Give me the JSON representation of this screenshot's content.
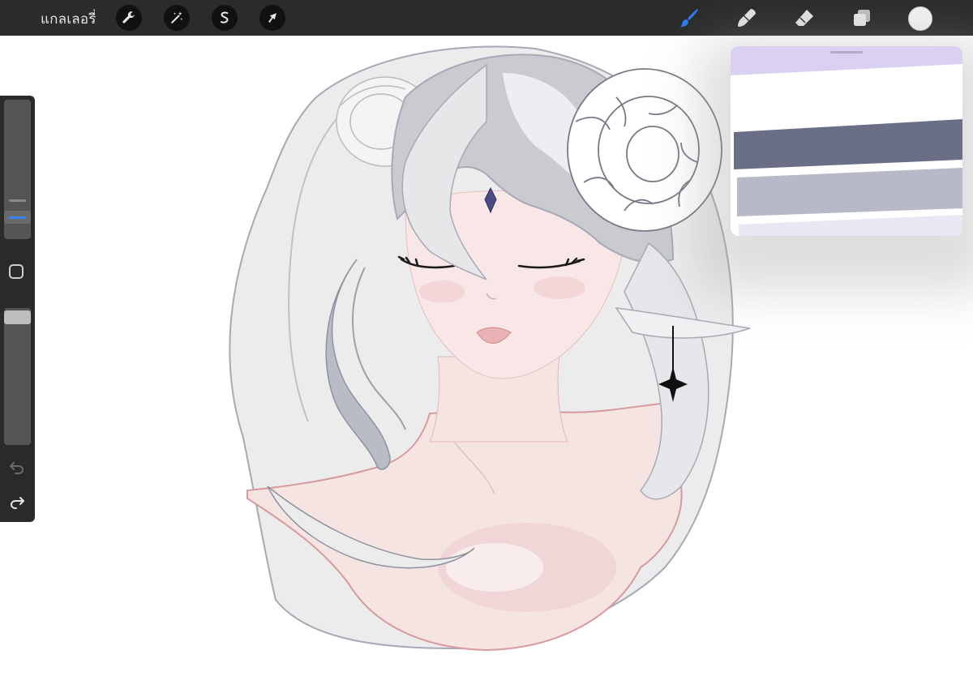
{
  "topbar": {
    "gallery_label": "แกลเลอรี่",
    "actions": [
      {
        "name": "actions-wrench",
        "icon": "wrench-icon"
      },
      {
        "name": "adjustments-wand",
        "icon": "magic-wand-icon"
      },
      {
        "name": "selection",
        "icon": "selection-s-icon"
      },
      {
        "name": "transform",
        "icon": "arrow-cursor-icon"
      }
    ],
    "tools": [
      {
        "name": "brush",
        "icon": "brush-icon",
        "active": true
      },
      {
        "name": "smudge",
        "icon": "smudge-icon",
        "active": false
      },
      {
        "name": "eraser",
        "icon": "eraser-icon",
        "active": false
      },
      {
        "name": "layers",
        "icon": "layers-icon",
        "active": false
      }
    ],
    "current_color": "#f2f2f2",
    "active_tool_color": "#2f7cf6"
  },
  "sidebar": {
    "brush_size_level": 0.12,
    "brush_opacity_level": 0.98,
    "undo_icon": "undo-icon",
    "redo_icon": "redo-icon"
  },
  "color_panel": {
    "stripe_colors": [
      "#d9d0f2",
      "#ffffff",
      "#6b6f86",
      "#b7b9c9",
      "#e9e7f3"
    ]
  },
  "canvas": {
    "palette": {
      "skin": "#f6e4e2",
      "skin_shadow": "#e9c9c8",
      "outline_skin": "#d79a9f",
      "hair": "#b9bcc4",
      "hair_light": "#e9eaee",
      "outline": "#a7a9b6",
      "background_shape": "#ebebeb",
      "horn": "#ffffff",
      "gem": "#4b4b86"
    }
  }
}
